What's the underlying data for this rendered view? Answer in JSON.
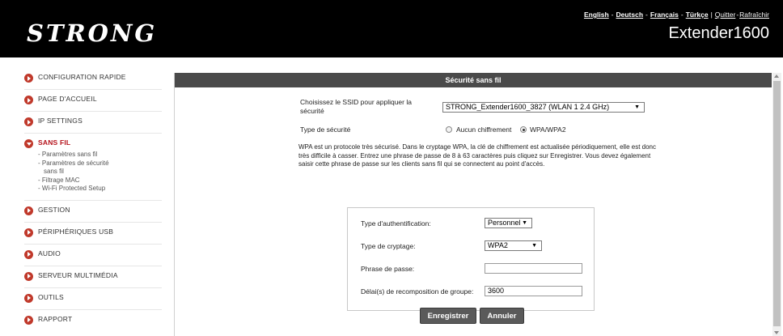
{
  "header": {
    "logo_text": "STRONG",
    "device_name": "Extender1600",
    "languages": [
      "English",
      "Deutsch",
      "Français",
      "Türkçe"
    ],
    "quit_label": "Quitter",
    "refresh_label": "Rafraîchir",
    "separator": "-",
    "divider": "|"
  },
  "sidebar": {
    "items": [
      {
        "label": "CONFIGURATION RAPIDE"
      },
      {
        "label": "PAGE D'ACCUEIL"
      },
      {
        "label": "IP SETTINGS"
      },
      {
        "label": "SANS FIL"
      },
      {
        "label": "GESTION"
      },
      {
        "label": "PÉRIPHÉRIQUES USB"
      },
      {
        "label": "AUDIO"
      },
      {
        "label": "SERVEUR MULTIMÉDIA"
      },
      {
        "label": "OUTILS"
      },
      {
        "label": "RAPPORT"
      }
    ],
    "sans_fil_sub": [
      "- Paramètres sans fil",
      "- Paramètres de sécurité",
      "sans fil",
      "- Filtrage MAC",
      "- Wi-Fi Protected Setup"
    ]
  },
  "panel": {
    "title": "Sécurité sans fil",
    "ssid_label": "Choisissez le SSID pour appliquer la sécurité",
    "ssid_value": "STRONG_Extender1600_3827 (WLAN 1 2.4 GHz)",
    "security_type_label": "Type de sécurité",
    "radio_none_label": "Aucun chiffrement",
    "radio_wpa_label": "WPA/WPA2",
    "description": "WPA est un protocole très sécurisé. Dans le cryptage WPA, la clé de chiffrement est actualisée périodiquement, elle est donc très difficile à casser. Entrez une phrase de passe de 8 à 63 caractères puis cliquez sur Enregistrer. Vous devez également saisir cette phrase de passe sur les clients sans fil qui se connectent au point d'accès.",
    "form": {
      "auth_label": "Type d'authentification:",
      "auth_value": "Personnel",
      "cipher_label": "Type de cryptage:",
      "cipher_value": "WPA2",
      "passphrase_label": "Phrase de passe:",
      "passphrase_value": "",
      "rekey_label": "Délai(s) de recomposition de groupe:",
      "rekey_value": "3600"
    },
    "save_label": "Enregistrer",
    "cancel_label": "Annuler"
  },
  "colors": {
    "header_bg": "#000000",
    "accent_red": "#c0392b",
    "panel_title_bg": "#4a4a4a",
    "button_bg": "#5a5a5a"
  }
}
